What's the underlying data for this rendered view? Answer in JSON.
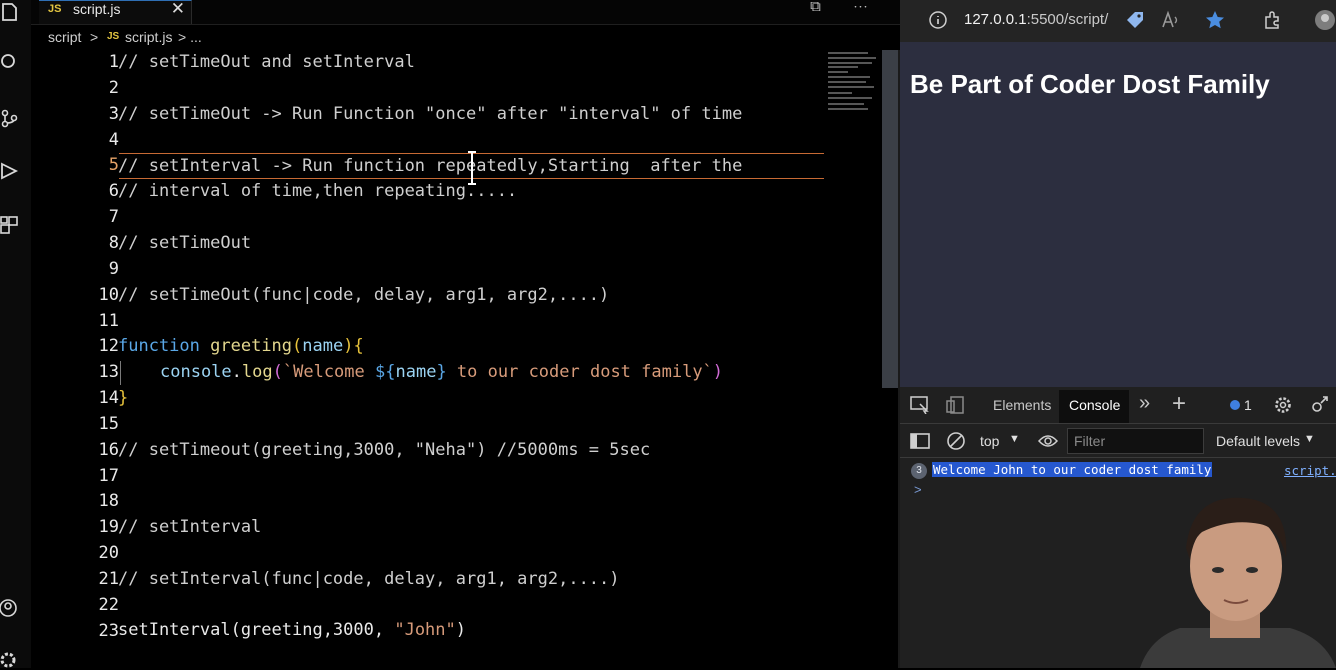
{
  "editor": {
    "tab": {
      "badge": "JS",
      "name": "script.js",
      "close": "✕"
    },
    "tab_actions": "⧉ ⋯",
    "breadcrumb": {
      "folder": "script",
      "sep": ">",
      "badge": "JS",
      "file": "script.js",
      "more": "> ..."
    },
    "active_line": 5,
    "lines": [
      {
        "n": "1"
      },
      {
        "n": "2"
      },
      {
        "n": "3"
      },
      {
        "n": "4"
      },
      {
        "n": "5"
      },
      {
        "n": "6"
      },
      {
        "n": "7"
      },
      {
        "n": "8"
      },
      {
        "n": "9"
      },
      {
        "n": "10"
      },
      {
        "n": "11"
      },
      {
        "n": "12"
      },
      {
        "n": "13"
      },
      {
        "n": "14"
      },
      {
        "n": "15"
      },
      {
        "n": "16"
      },
      {
        "n": "17"
      },
      {
        "n": "18"
      },
      {
        "n": "19"
      },
      {
        "n": "20"
      },
      {
        "n": "21"
      },
      {
        "n": "22"
      },
      {
        "n": "23"
      }
    ],
    "code": {
      "l1": "// setTimeOut and setInterval",
      "l3": "// setTimeOut -> Run Function \"once\" after \"interval\" of time",
      "l5": "// setInterval -> Run function repeatedly,Starting  after the",
      "l6": "// interval of time,then repeating.....",
      "l8": "// setTimeOut",
      "l10": "// setTimeOut(func|code, delay, arg1, arg2,....)",
      "l12": {
        "kw": "function",
        "fn": "greeting",
        "open": "(",
        "param": "name",
        "close": ")",
        "brace": "{"
      },
      "l13": {
        "obj": "console",
        "dot": ".",
        "method": "log",
        "paren_open": "(",
        "tick_open": "`Welcome ",
        "tpl_open": "${",
        "var": "name",
        "tpl_close": "}",
        "rest": " to our coder dost family`",
        "paren_close": ")"
      },
      "l14": "}",
      "l16": "// setTimeout(greeting,3000, \"Neha\") //5000ms = 5sec",
      "l19": "// setInterval",
      "l21": "// setInterval(func|code, delay, arg1, arg2,....)",
      "l23": {
        "call": "setInterval(greeting,3000, ",
        "str": "\"John\"",
        "end": ")"
      }
    }
  },
  "browser": {
    "url_host": "127.0.0.1",
    "url_rest": ":5500/script/",
    "page_heading": "Be Part of Coder Dost Family",
    "devtools": {
      "tabs": {
        "elements": "Elements",
        "console": "Console",
        "more": "»",
        "add": "+"
      },
      "issues_count": "1",
      "context": "top",
      "filter_placeholder": "Filter",
      "levels": "Default levels",
      "message": {
        "count": "3",
        "text": "Welcome John to our coder dost family",
        "source": "script."
      },
      "prompt": ">"
    }
  },
  "colors": {
    "accent_tab": "#2f6fb4",
    "selection_border": "#c76a34",
    "console_highlight": "#2658cf",
    "page_bg": "#2c2e3f"
  }
}
